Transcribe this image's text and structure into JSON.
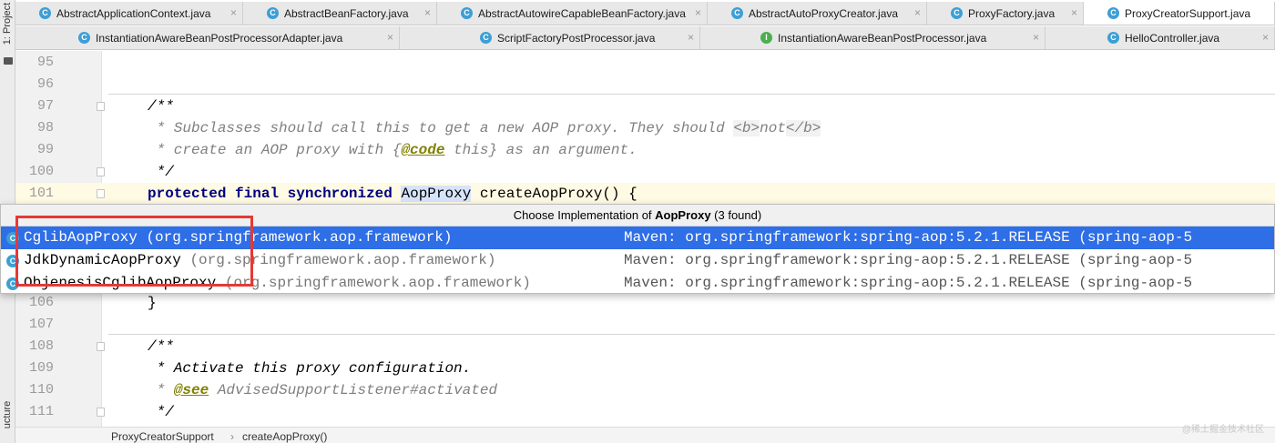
{
  "left_strip": {
    "project_label": "1: Project",
    "structure_label": "ucture"
  },
  "tabs_row1": [
    {
      "label": "AbstractApplicationContext.java",
      "icon": "class-icon"
    },
    {
      "label": "AbstractBeanFactory.java",
      "icon": "class-icon"
    },
    {
      "label": "AbstractAutowireCapableBeanFactory.java",
      "icon": "class-icon"
    },
    {
      "label": "AbstractAutoProxyCreator.java",
      "icon": "class-icon"
    },
    {
      "label": "ProxyFactory.java",
      "icon": "class-icon"
    },
    {
      "label": "ProxyCreatorSupport.java",
      "icon": "class-icon",
      "active": true
    }
  ],
  "tabs_row2": [
    {
      "label": "InstantiationAwareBeanPostProcessorAdapter.java",
      "icon": "class-icon"
    },
    {
      "label": "ScriptFactoryPostProcessor.java",
      "icon": "class-icon"
    },
    {
      "label": "InstantiationAwareBeanPostProcessor.java",
      "icon": "interface-icon"
    },
    {
      "label": "HelloController.java",
      "icon": "class-icon"
    }
  ],
  "editor": {
    "lines": [
      {
        "num": "95"
      },
      {
        "num": "96"
      },
      {
        "num": "97",
        "parts": [
          "/**"
        ]
      },
      {
        "num": "98",
        "parts": [
          " * Subclasses should call this to get a new AOP proxy. They should ",
          "<b>",
          "not",
          "</b>"
        ]
      },
      {
        "num": "99",
        "parts": [
          " * create an AOP proxy with {",
          "@code",
          " this} as an argument."
        ]
      },
      {
        "num": "100",
        "parts": [
          " */"
        ]
      },
      {
        "num": "101",
        "parts": [
          "protected",
          " ",
          "final",
          " ",
          "synchronized",
          " ",
          "AopProxy",
          " createAopProxy() {"
        ]
      },
      {
        "num": "106",
        "parts": [
          "}"
        ]
      },
      {
        "num": "107"
      },
      {
        "num": "108",
        "parts": [
          "/**"
        ]
      },
      {
        "num": "109",
        "parts": [
          " * Activate this proxy configuration."
        ]
      },
      {
        "num": "110",
        "parts": [
          " * ",
          "@see",
          " AdvisedSupportListener#activated"
        ]
      },
      {
        "num": "111",
        "parts": [
          " */"
        ]
      }
    ]
  },
  "popup": {
    "title_prefix": "Choose Implementation of ",
    "title_class": "AopProxy",
    "title_suffix": " (3 found)",
    "items": [
      {
        "name": "CglibAopProxy",
        "package": "(org.springframework.aop.framework)",
        "maven": "Maven: org.springframework:spring-aop:5.2.1.RELEASE (spring-aop-5",
        "selected": true
      },
      {
        "name": "JdkDynamicAopProxy",
        "package": "(org.springframework.aop.framework)",
        "maven": "Maven: org.springframework:spring-aop:5.2.1.RELEASE (spring-aop-5"
      },
      {
        "name": "ObjenesisCglibAopProxy",
        "package": "(org.springframework.aop.framework)",
        "maven": "Maven: org.springframework:spring-aop:5.2.1.RELEASE (spring-aop-5"
      }
    ]
  },
  "breadcrumb": {
    "class": "ProxyCreatorSupport",
    "separator": "›",
    "method": "createAopProxy()"
  },
  "watermark": "@稀土掘金技术社区",
  "colors": {
    "selection": "#2e6ee6",
    "highlight_box": "#e53935",
    "keyword": "#000080",
    "javadoc_tag": "#808000"
  }
}
